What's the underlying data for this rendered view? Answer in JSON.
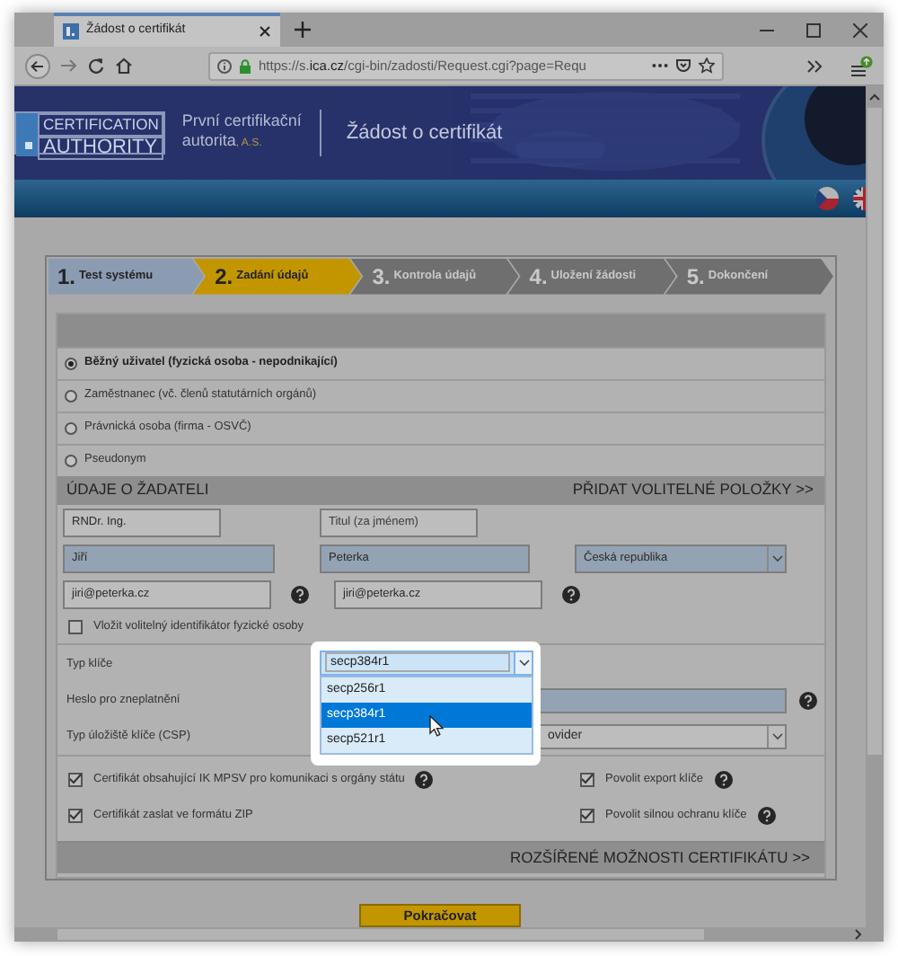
{
  "browser": {
    "tab_title": "Žádost o certifikát",
    "url": "https://s.**ica.cz**/cgi-bin/zadosti/Request.cgi?page=Requ"
  },
  "header": {
    "logo_top": "CERTIFICATION",
    "logo_bottom": "AUTHORITY",
    "org_line1": "První certifikační",
    "org_line2": "autorita",
    "org_suffix": ", A.S.",
    "title": "Žádost o certifikát"
  },
  "steps": [
    {
      "number": "1.",
      "label": "Test systému",
      "completed": true,
      "selected": false
    },
    {
      "number": "2.",
      "label": "Zadání údajů",
      "completed": false,
      "selected": true
    },
    {
      "number": "3.",
      "label": "Kontrola údajů",
      "completed": false,
      "selected": false
    },
    {
      "number": "4.",
      "label": "Uložení žádosti",
      "completed": false,
      "selected": false
    },
    {
      "number": "5.",
      "label": "Dokončení",
      "completed": false,
      "selected": false
    }
  ],
  "applicant_types": [
    {
      "label": "Běžný uživatel (fyzická osoba - nepodnikající)",
      "selected": true
    },
    {
      "label": "Zaměstnanec (vč. členů statutárních orgánů)",
      "selected": false
    },
    {
      "label": "Právnická osoba (firma - OSVČ)",
      "selected": false
    },
    {
      "label": "Pseudonym",
      "selected": false
    }
  ],
  "section": {
    "title": "ÚDAJE O ŽADATELI",
    "action": "PŘIDAT VOLITELNÉ POLOŽKY >>"
  },
  "form_rows": [
    {
      "fields": [
        {
          "kind": "input",
          "value": "RNDr. Ing.",
          "required": false,
          "help": false
        },
        {
          "kind": "input",
          "placeholder": "Titul (za jménem)",
          "required": false,
          "help": false
        }
      ]
    },
    {
      "fields": [
        {
          "kind": "input",
          "value": "Jiří",
          "required": true,
          "help": false
        },
        {
          "kind": "input",
          "value": "Peterka",
          "required": true,
          "help": false
        },
        {
          "kind": "select",
          "value": "Česká republika",
          "required": true,
          "help": false
        }
      ]
    },
    {
      "fields": [
        {
          "kind": "input",
          "value": "jiri@peterka.cz",
          "required": false,
          "help": true
        },
        {
          "kind": "input",
          "value": "jiri@peterka.cz",
          "required": false,
          "help": true
        }
      ]
    }
  ],
  "optional_id": {
    "label": "Vložit volitelný identifikátor fyzické osoby",
    "checked": false
  },
  "key_type": {
    "label": "Typ klíče",
    "value": "secp384r1",
    "options": [
      {
        "label": "secp256r1",
        "selected": false
      },
      {
        "label": "secp384r1",
        "selected": true
      },
      {
        "label": "secp521r1",
        "selected": false
      }
    ]
  },
  "revocation_password": {
    "label": "Heslo pro zneplatnění",
    "help": true
  },
  "csp": {
    "label": "Typ úložiště klíče (CSP)",
    "value": "ovider"
  },
  "options": [
    {
      "label": "Certifikát obsahující IK MPSV pro komunikaci s orgány státu",
      "checked": true,
      "help": true
    },
    {
      "label": "Povolit export klíče",
      "checked": true,
      "help": true
    },
    {
      "label": "Certifikát zaslat ve formátu ZIP",
      "checked": true,
      "help": false
    },
    {
      "label": "Povolit silnou ochranu klíče",
      "checked": true,
      "help": true
    }
  ],
  "advanced": "ROZŠÍŘENÉ MOŽNOSTI CERTIFIKÁTU >>",
  "continue_button": "Pokračovat"
}
